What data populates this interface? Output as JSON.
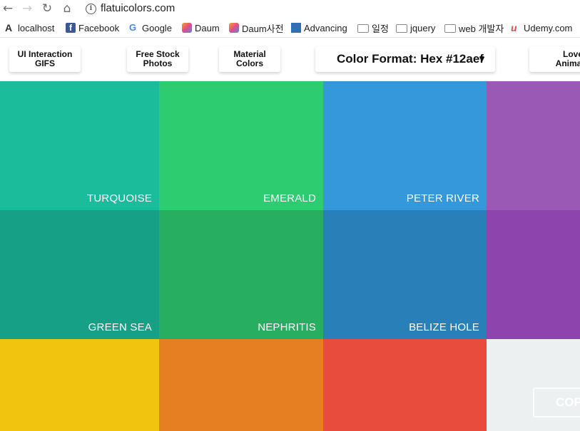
{
  "browser": {
    "url": "flatuicolors.com",
    "bookmarks": [
      {
        "label": "localhost",
        "icon": "a-logo-icon"
      },
      {
        "label": "Facebook",
        "icon": "facebook-icon"
      },
      {
        "label": "Google",
        "icon": "google-icon"
      },
      {
        "label": "Daum",
        "icon": "daum-icon"
      },
      {
        "label": "Daum사전",
        "icon": "daum-icon"
      },
      {
        "label": "Advancing",
        "icon": "advancing-icon"
      },
      {
        "label": "일정",
        "icon": "folder-icon"
      },
      {
        "label": "jquery",
        "icon": "folder-icon"
      },
      {
        "label": "web 개발자",
        "icon": "folder-icon"
      },
      {
        "label": "Udemy.com",
        "icon": "udemy-icon"
      }
    ]
  },
  "nav": {
    "ui_gifs": "UI Interaction GIFS",
    "stock_photos": "Free Stock Photos",
    "material": "Material Colors",
    "format": "Color Format: Hex #12aef",
    "format_caret": "▼",
    "lovely": "Lovely Animation"
  },
  "colors": [
    {
      "name": "TURQUOISE",
      "hex": "#1abc9c"
    },
    {
      "name": "EMERALD",
      "hex": "#2ecc71"
    },
    {
      "name": "PETER RIVER",
      "hex": "#3498db"
    },
    {
      "name": "",
      "hex": "#9b59b6"
    },
    {
      "name": "GREEN SEA",
      "hex": "#16a085"
    },
    {
      "name": "NEPHRITIS",
      "hex": "#27ae60"
    },
    {
      "name": "BELIZE HOLE",
      "hex": "#2980b9"
    },
    {
      "name": "",
      "hex": "#8e44ad"
    },
    {
      "name": "",
      "hex": "#f1c40f"
    },
    {
      "name": "",
      "hex": "#e67e22"
    },
    {
      "name": "",
      "hex": "#e74c3c"
    },
    {
      "name": "",
      "hex": "#ecf0f1"
    }
  ],
  "copy_label": "COPY"
}
